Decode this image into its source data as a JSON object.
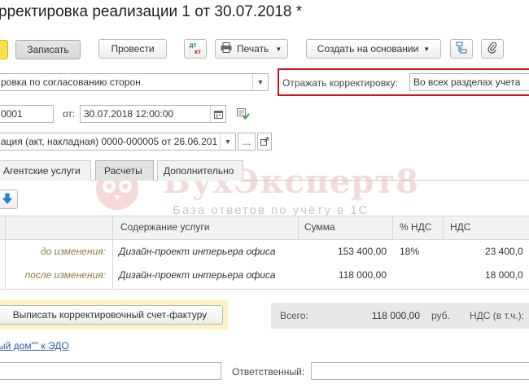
{
  "window": {
    "title": "рректировка реализации 1 от 30.07.2018 *"
  },
  "toolbar": {
    "save_label": "Записать",
    "post_label": "Провести",
    "dt_kt_label_top": "дт",
    "dt_kt_label_bottom": "кт",
    "print_label": "Печать",
    "create_based_label": "Создать на основании"
  },
  "form": {
    "reason_value": "ровка по согласованию сторон",
    "reflect_label": "Отражать корректировку:",
    "reflect_value": "Во всех разделах учета",
    "number_value": "0001",
    "date_label": "от:",
    "date_value": "30.07.2018 12:00:00",
    "base_doc_value": "ация (акт, накладная) 0000-000005 от 26.06.201",
    "base_doc_more": "..."
  },
  "tabs": [
    {
      "label": "Агентские услуги"
    },
    {
      "label": "Расчеты"
    },
    {
      "label": "Дополнительно"
    }
  ],
  "table": {
    "columns": [
      "Содержание услуги",
      "Сумма",
      "% НДС",
      "НДС"
    ],
    "rows": [
      {
        "label": "до изменения:",
        "content": "Дизайн-проект интерьера офиса",
        "sum": "153 400,00",
        "vat_rate": "18%",
        "vat": "23 400,0"
      },
      {
        "label": "после изменения:",
        "content": "Дизайн-проект интерьера офиса",
        "sum": "118 000,00",
        "vat_rate": "",
        "vat": "18 000,0"
      }
    ]
  },
  "footer": {
    "invoice_button": "Выписать корректировочный счет-фактуру",
    "total_label": "Всего:",
    "total_value": "118 000,00",
    "currency": "руб.",
    "vat_label": "НДС (в т.ч.):",
    "edo_link": "ый дом\"\" к ЭДО",
    "responsible_label": "Ответственный:"
  },
  "watermark": {
    "brand": "БухЭксперт8",
    "tagline": "База ответов по учёту в 1С"
  },
  "colors": {
    "accent_yellow": "#ffe14d",
    "highlight_red": "#d0121b",
    "link_blue": "#2a5db0",
    "footer_yellow": "#fff3c4"
  }
}
